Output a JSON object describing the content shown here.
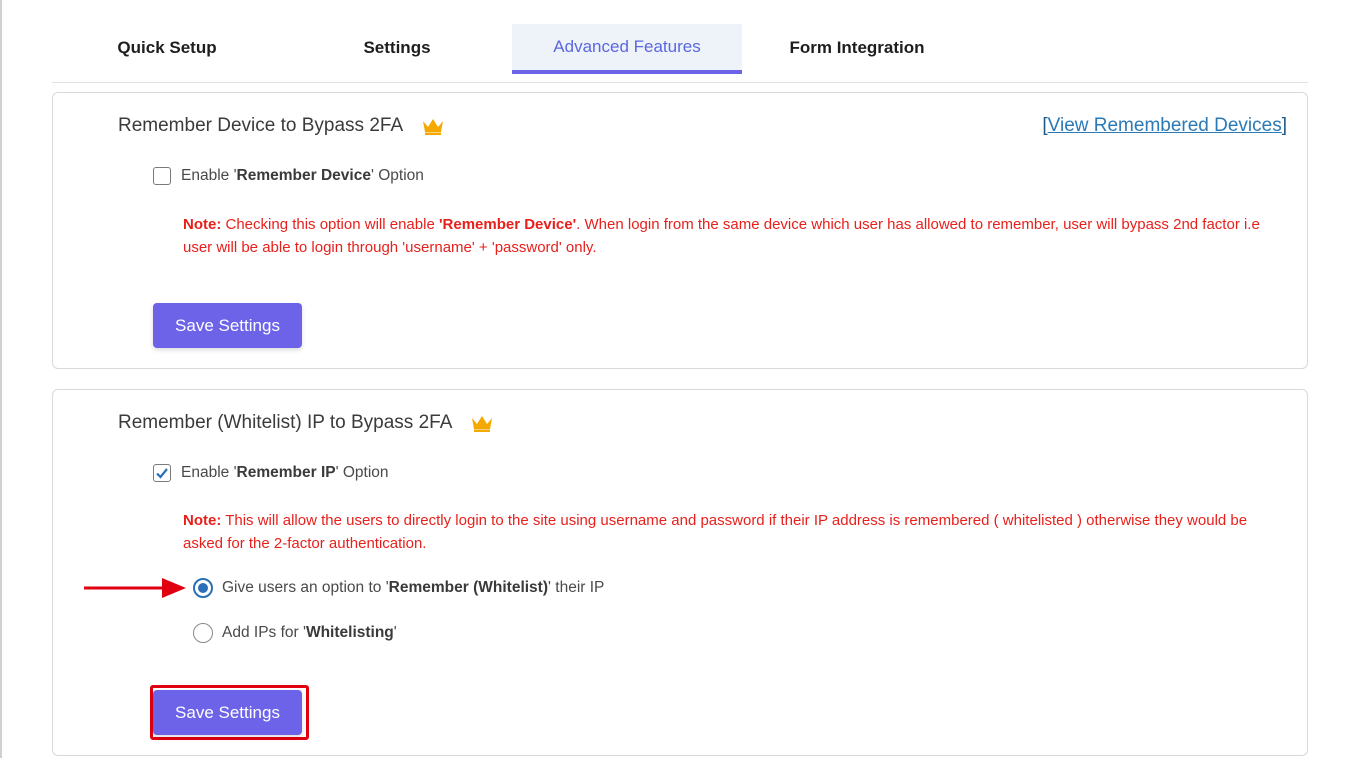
{
  "tabs": [
    {
      "label": "Quick Setup"
    },
    {
      "label": "Settings"
    },
    {
      "label": "Advanced Features",
      "active": true
    },
    {
      "label": "Form Integration"
    }
  ],
  "device_section": {
    "title": "Remember Device to Bypass 2FA",
    "link_open": "[",
    "link_text": "View Remembered Devices",
    "link_close": "]",
    "checkbox": {
      "prefix": "Enable '",
      "bold": "Remember Device",
      "suffix": "' Option",
      "checked": false
    },
    "note": {
      "label": "Note:",
      "text1": " Checking this option will enable ",
      "bold": "'Remember Device'",
      "text2": ". When login from the same device which user has allowed to remember, user will bypass 2nd factor i.e user will be able to login through 'username' + 'password' only."
    },
    "save_label": "Save Settings"
  },
  "ip_section": {
    "title": "Remember (Whitelist) IP to Bypass 2FA",
    "checkbox": {
      "prefix": "Enable '",
      "bold": "Remember IP",
      "suffix": "' Option",
      "checked": true
    },
    "note": {
      "label": "Note:",
      "text": " This will allow the users to directly login to the site using username and password if their IP address is remembered ( whitelisted ) otherwise they would be asked for the 2-factor authentication."
    },
    "radio_options": [
      {
        "prefix": "Give users an option to '",
        "bold": "Remember (Whitelist)",
        "suffix": "' their IP",
        "selected": true
      },
      {
        "prefix": "Add IPs for '",
        "bold": "Whitelisting",
        "suffix": "'",
        "selected": false
      }
    ],
    "save_label": "Save Settings"
  },
  "colors": {
    "accent": "#6c63e8",
    "note_red": "#e8201c",
    "highlight_red": "#e10010",
    "link_blue": "#2a7ab8",
    "crown_gold": "#f5a800"
  },
  "icons": {
    "crown": "crown-icon",
    "check": "check-icon",
    "arrow": "arrow-right-icon"
  }
}
